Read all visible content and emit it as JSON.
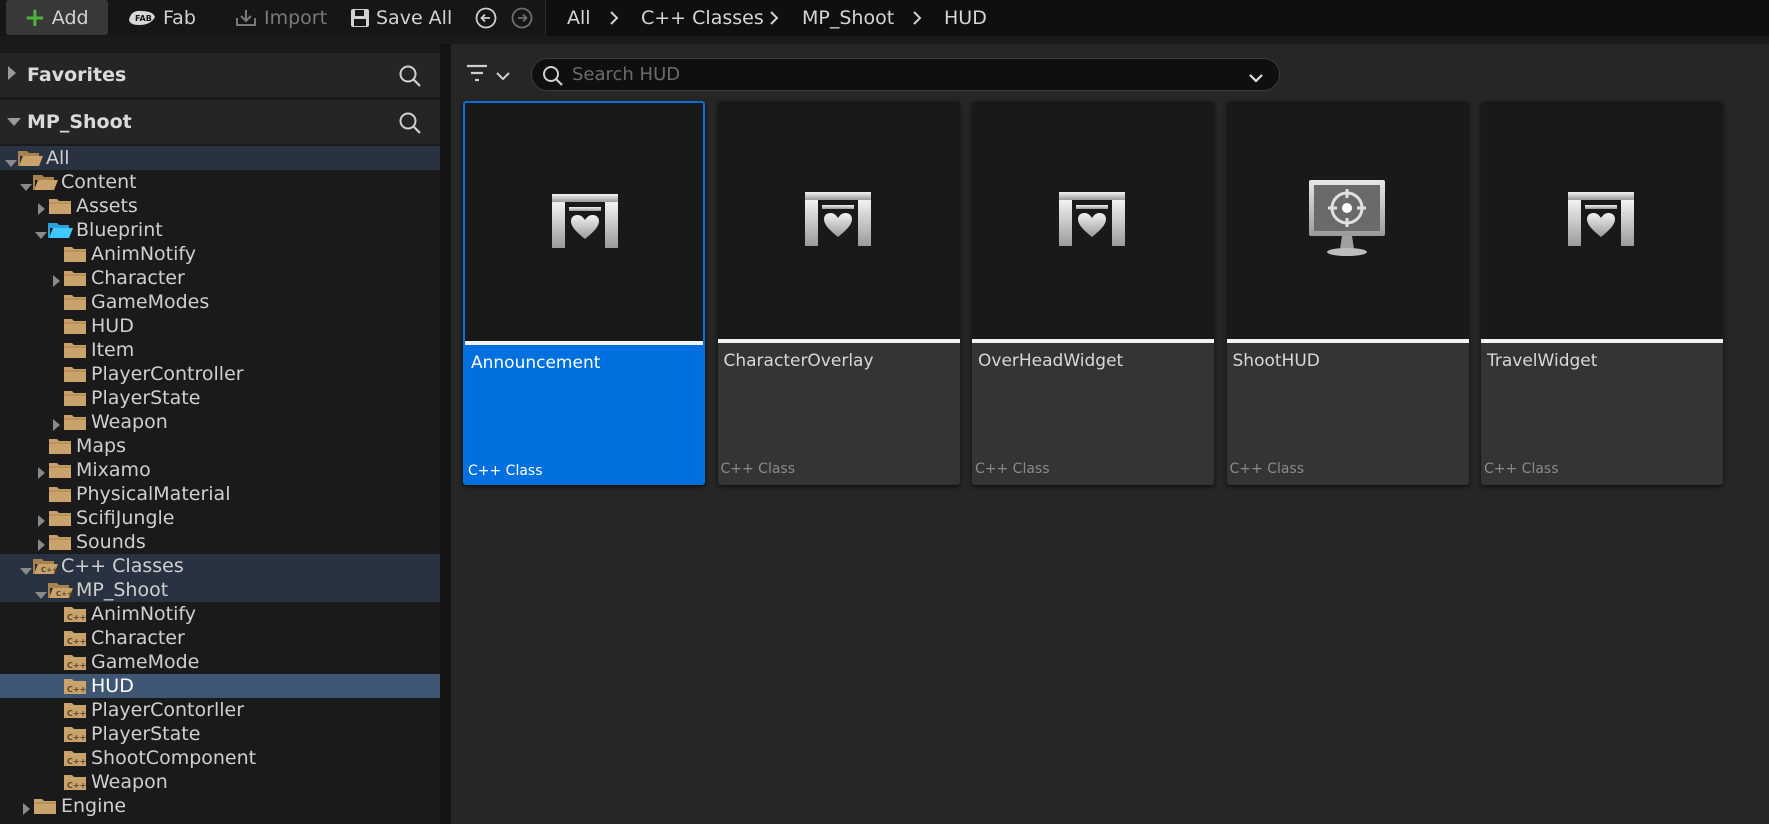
{
  "toolbar": {
    "add_label": "Add",
    "fab_label": "Fab",
    "import_label": "Import",
    "save_all_label": "Save All"
  },
  "breadcrumb": [
    "All",
    "C++ Classes",
    "MP_Shoot",
    "HUD"
  ],
  "sidebar": {
    "favorites_label": "Favorites",
    "project_label": "MP_Shoot",
    "tree": [
      {
        "label": "All",
        "indent": 0,
        "expanded": true,
        "type": "open",
        "state": "hl"
      },
      {
        "label": "Content",
        "indent": 1,
        "expanded": true,
        "type": "open"
      },
      {
        "label": "Assets",
        "indent": 2,
        "expander": "right",
        "type": "closed"
      },
      {
        "label": "Blueprint",
        "indent": 2,
        "expanded": true,
        "type": "open-cyan"
      },
      {
        "label": "AnimNotify",
        "indent": 3,
        "type": "closed"
      },
      {
        "label": "Character",
        "indent": 3,
        "expander": "right",
        "type": "closed"
      },
      {
        "label": "GameModes",
        "indent": 3,
        "type": "closed"
      },
      {
        "label": "HUD",
        "indent": 3,
        "type": "closed"
      },
      {
        "label": "Item",
        "indent": 3,
        "type": "closed"
      },
      {
        "label": "PlayerController",
        "indent": 3,
        "type": "closed"
      },
      {
        "label": "PlayerState",
        "indent": 3,
        "type": "closed"
      },
      {
        "label": "Weapon",
        "indent": 3,
        "expander": "right",
        "type": "closed"
      },
      {
        "label": "Maps",
        "indent": 2,
        "type": "closed"
      },
      {
        "label": "Mixamo",
        "indent": 2,
        "expander": "right",
        "type": "closed"
      },
      {
        "label": "PhysicalMaterial",
        "indent": 2,
        "type": "closed"
      },
      {
        "label": "ScifiJungle",
        "indent": 2,
        "expander": "right",
        "type": "closed"
      },
      {
        "label": "Sounds",
        "indent": 2,
        "expander": "right",
        "type": "closed"
      },
      {
        "label": "C++ Classes",
        "indent": 1,
        "expanded": true,
        "type": "cpp-open",
        "state": "hl"
      },
      {
        "label": "MP_Shoot",
        "indent": 2,
        "expanded": true,
        "type": "cpp-open",
        "state": "hl"
      },
      {
        "label": "AnimNotify",
        "indent": 3,
        "type": "cpp"
      },
      {
        "label": "Character",
        "indent": 3,
        "type": "cpp"
      },
      {
        "label": "GameMode",
        "indent": 3,
        "type": "cpp"
      },
      {
        "label": "HUD",
        "indent": 3,
        "type": "cpp",
        "state": "sel"
      },
      {
        "label": "PlayerContorller",
        "indent": 3,
        "type": "cpp"
      },
      {
        "label": "PlayerState",
        "indent": 3,
        "type": "cpp"
      },
      {
        "label": "ShootComponent",
        "indent": 3,
        "type": "cpp"
      },
      {
        "label": "Weapon",
        "indent": 3,
        "type": "cpp"
      },
      {
        "label": "Engine",
        "indent": 1,
        "expander": "right",
        "type": "closed"
      }
    ]
  },
  "search": {
    "placeholder": "Search HUD"
  },
  "assets": [
    {
      "name": "Announcement",
      "type": "C++ Class",
      "icon": "widget-icon",
      "selected": true
    },
    {
      "name": "CharacterOverlay",
      "type": "C++ Class",
      "icon": "widget-icon"
    },
    {
      "name": "OverHeadWidget",
      "type": "C++ Class",
      "icon": "widget-icon"
    },
    {
      "name": "ShootHUD",
      "type": "C++ Class",
      "icon": "hud-monitor-icon"
    },
    {
      "name": "TravelWidget",
      "type": "C++ Class",
      "icon": "widget-icon"
    }
  ],
  "colors": {
    "selection_blue": "#0070e0",
    "folder_tan": "#c9a36b",
    "folder_cyan": "#3fc7ff",
    "add_green": "#4fb13a"
  }
}
